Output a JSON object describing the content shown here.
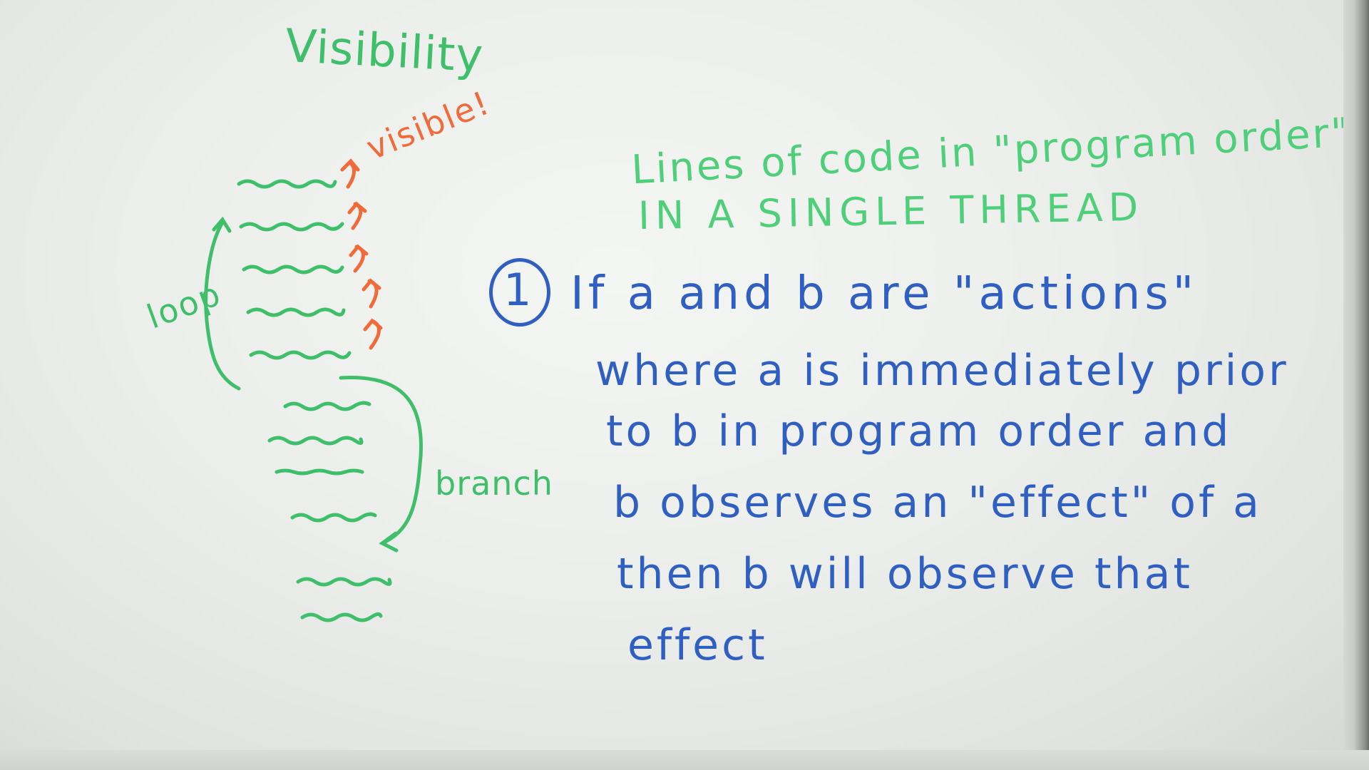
{
  "board": {
    "title": "Visibility",
    "label_visible": "visible!",
    "label_loop": "loop",
    "label_branch": "branch",
    "rule_heading_line1": "Lines of code in \"program order\"",
    "rule_heading_line2": "IN A SINGLE THREAD",
    "item_number": "1",
    "item_lines": [
      "If a and b are \"actions\"",
      "where a is immediately prior",
      "to b in program order and",
      "b observes an \"effect\" of a",
      "then b will observe that",
      "effect"
    ]
  },
  "colors": {
    "marker_green": "#3fbf6a",
    "marker_orange": "#f06a3a",
    "marker_blue": "#2f5fc0",
    "board": "#eceeeb"
  }
}
